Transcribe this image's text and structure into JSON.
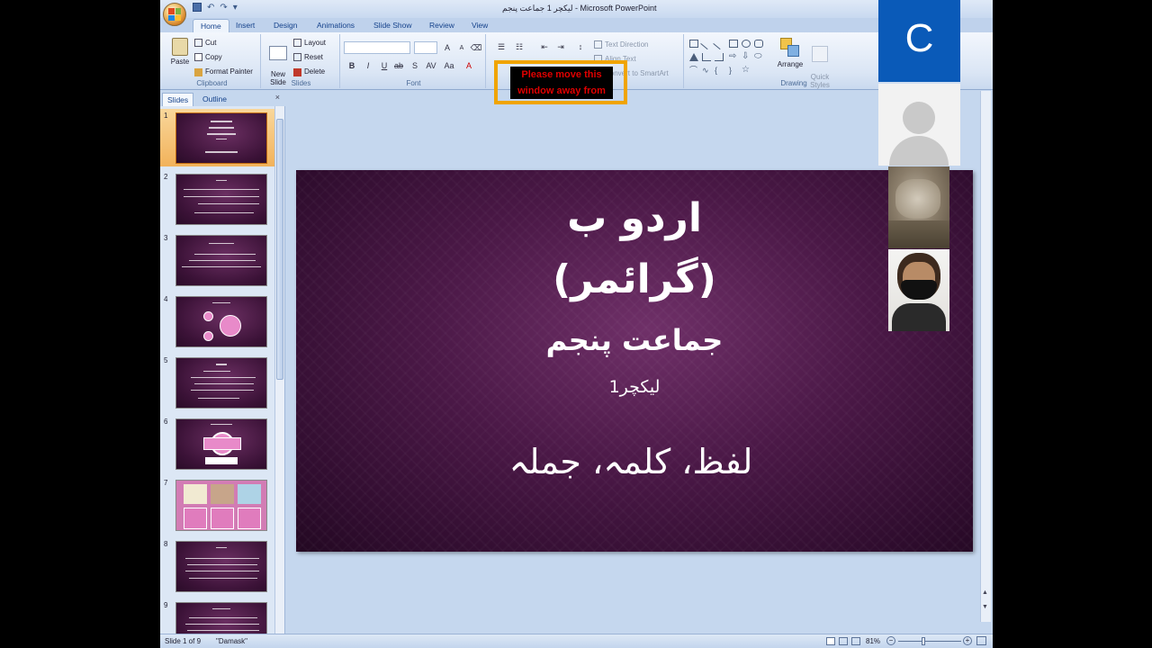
{
  "window": {
    "title": "لیکچر 1 جماعت پنجم - Microsoft PowerPoint"
  },
  "ribbon": {
    "tabs": [
      "Home",
      "Insert",
      "Design",
      "Animations",
      "Slide Show",
      "Review",
      "View"
    ],
    "clipboard": {
      "label": "Clipboard",
      "paste": "Paste",
      "cut": "Cut",
      "copy": "Copy",
      "format_painter": "Format Painter"
    },
    "slides": {
      "label": "Slides",
      "new_slide": "New\nSlide",
      "layout": "Layout",
      "reset": "Reset",
      "delete": "Delete"
    },
    "font": {
      "label": "Font",
      "font_name": "",
      "font_size": ""
    },
    "paragraph": {
      "text_direction": "Text Direction",
      "align_text": "Align Text",
      "convert_smartart": "Convert to SmartArt"
    },
    "drawing": {
      "label": "Drawing",
      "arrange": "Arrange",
      "quick_styles": "Quick\nStyles"
    }
  },
  "share_warning": {
    "text": "Please move this window away from"
  },
  "slides_panel": {
    "tabs": [
      "Slides",
      "Outline"
    ],
    "close": "×",
    "thumbnails": [
      {
        "num": "1",
        "selected": true
      },
      {
        "num": "2",
        "selected": false
      },
      {
        "num": "3",
        "selected": false
      },
      {
        "num": "4",
        "selected": false
      },
      {
        "num": "5",
        "selected": false
      },
      {
        "num": "6",
        "selected": false
      },
      {
        "num": "7",
        "selected": false
      },
      {
        "num": "8",
        "selected": false
      },
      {
        "num": "9",
        "selected": false
      }
    ]
  },
  "slide": {
    "line1": "اردو ب",
    "line2": "(گرائمر)",
    "line3": "جماعت پنجم",
    "line4": "لیکچر1",
    "line5": "لفظ، کلمہ، جملہ"
  },
  "status_bar": {
    "slide_position": "Slide 1 of 9",
    "theme": "\"Damask\"",
    "zoom": "81%"
  },
  "participants": [
    {
      "initial": "C",
      "color": "#0a5ab8"
    },
    {
      "label": "",
      "type": "silhouette"
    },
    {
      "label": "",
      "type": "camera"
    },
    {
      "label": "",
      "type": "camera"
    }
  ]
}
